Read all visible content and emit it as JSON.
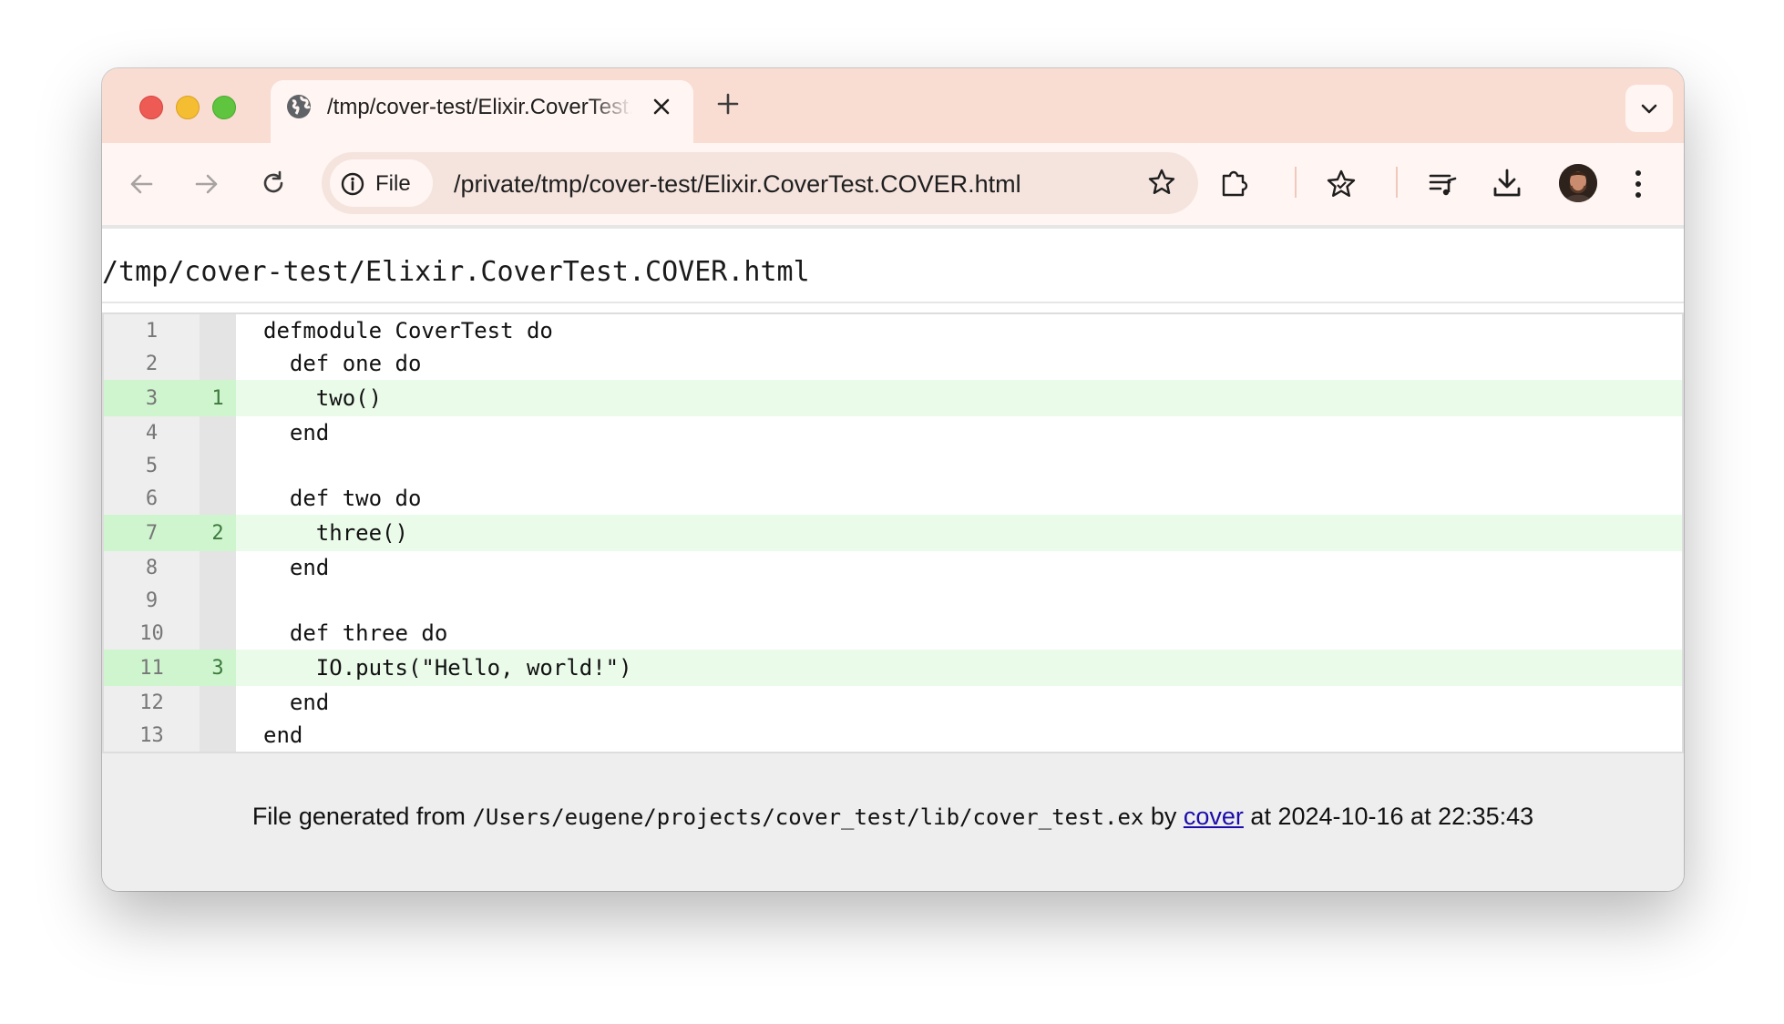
{
  "tab": {
    "title": "/tmp/cover-test/Elixir.CoverTest.COVER.html"
  },
  "address_bar": {
    "chip_label": "File",
    "url": "/private/tmp/cover-test/Elixir.CoverTest.COVER.html"
  },
  "page": {
    "title": "/tmp/cover-test/Elixir.CoverTest.COVER.html",
    "lines": [
      {
        "num": "1",
        "count": "",
        "code": "defmodule CoverTest do",
        "hit": false
      },
      {
        "num": "2",
        "count": "",
        "code": "  def one do",
        "hit": false
      },
      {
        "num": "3",
        "count": "1",
        "code": "    two()",
        "hit": true
      },
      {
        "num": "4",
        "count": "",
        "code": "  end",
        "hit": false
      },
      {
        "num": "5",
        "count": "",
        "code": "",
        "hit": false
      },
      {
        "num": "6",
        "count": "",
        "code": "  def two do",
        "hit": false
      },
      {
        "num": "7",
        "count": "2",
        "code": "    three()",
        "hit": true
      },
      {
        "num": "8",
        "count": "",
        "code": "  end",
        "hit": false
      },
      {
        "num": "9",
        "count": "",
        "code": "",
        "hit": false
      },
      {
        "num": "10",
        "count": "",
        "code": "  def three do",
        "hit": false
      },
      {
        "num": "11",
        "count": "3",
        "code": "    IO.puts(\"Hello, world!\")",
        "hit": true
      },
      {
        "num": "12",
        "count": "",
        "code": "  end",
        "hit": false
      },
      {
        "num": "13",
        "count": "",
        "code": "end",
        "hit": false
      }
    ],
    "footer": {
      "prefix": "File generated from ",
      "source_path": "/Users/eugene/projects/cover_test/lib/cover_test.ex",
      "by_text": " by ",
      "link_text": "cover",
      "suffix": " at 2024-10-16 at 22:35:43"
    }
  },
  "colors": {
    "hit_row": "#eafbea",
    "hit_gutter": "#cff5cf",
    "tab_strip": "#f9dcd2",
    "link": "#1a0dab"
  }
}
